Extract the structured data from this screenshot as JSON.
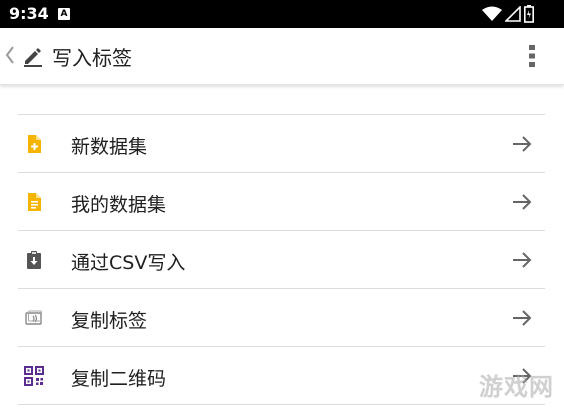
{
  "status_bar": {
    "time": "9:34",
    "notification_icon": "A",
    "icons": [
      "wifi-icon",
      "signal-icon",
      "battery-icon"
    ]
  },
  "app_bar": {
    "title": "写入标签",
    "leading_icons": [
      "chevron-left-icon",
      "pencil-icon"
    ],
    "trailing_icon": "more-vert-icon"
  },
  "menu": {
    "items": [
      {
        "label": "新数据集",
        "icon": "new-file-icon",
        "icon_color": "#F5B400"
      },
      {
        "label": "我的数据集",
        "icon": "document-icon",
        "icon_color": "#F5B400"
      },
      {
        "label": "通过CSV写入",
        "icon": "clipboard-download-icon",
        "icon_color": "#555555"
      },
      {
        "label": "复制标签",
        "icon": "nfc-card-icon",
        "icon_color": "#888888"
      },
      {
        "label": "复制二维码",
        "icon": "qr-code-icon",
        "icon_color": "#5B2D8E"
      }
    ],
    "trailing_icon": "arrow-right-icon"
  },
  "watermark": "游戏网"
}
